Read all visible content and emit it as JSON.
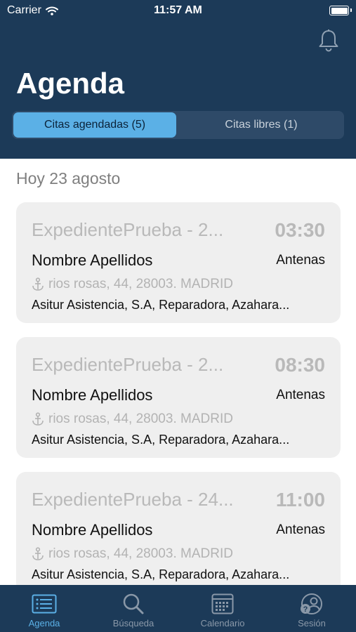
{
  "status_bar": {
    "carrier": "Carrier",
    "time": "11:57 AM"
  },
  "header": {
    "title": "Agenda",
    "tabs": [
      {
        "label": "Citas agendadas (5)",
        "active": true
      },
      {
        "label": "Citas libres (1)",
        "active": false
      }
    ]
  },
  "date_label": "Hoy 23 agosto",
  "appointments": [
    {
      "expediente": "ExpedientePrueba - 2...",
      "time": "03:30",
      "name": "Nombre Apellidos",
      "type": "Antenas",
      "address": "rios rosas, 44, 28003. MADRID",
      "company": "Asitur Asistencia, S.A, Reparadora, Azahara..."
    },
    {
      "expediente": "ExpedientePrueba - 2...",
      "time": "08:30",
      "name": "Nombre Apellidos",
      "type": "Antenas",
      "address": "rios rosas, 44, 28003. MADRID",
      "company": "Asitur Asistencia, S.A, Reparadora, Azahara..."
    },
    {
      "expediente": "ExpedientePrueba - 24...",
      "time": "11:00",
      "name": "Nombre Apellidos",
      "type": "Antenas",
      "address": "rios rosas, 44, 28003. MADRID",
      "company": "Asitur Asistencia, S.A, Reparadora, Azahara..."
    }
  ],
  "tabbar": [
    {
      "label": "Agenda",
      "icon": "list-icon",
      "active": true
    },
    {
      "label": "Búsqueda",
      "icon": "search-icon",
      "active": false
    },
    {
      "label": "Calendario",
      "icon": "calendar-icon",
      "active": false
    },
    {
      "label": "Sesión",
      "icon": "user-help-icon",
      "active": false
    }
  ],
  "colors": {
    "header": "#1c3a58",
    "accent": "#5bb0e6",
    "card": "#efefef"
  }
}
